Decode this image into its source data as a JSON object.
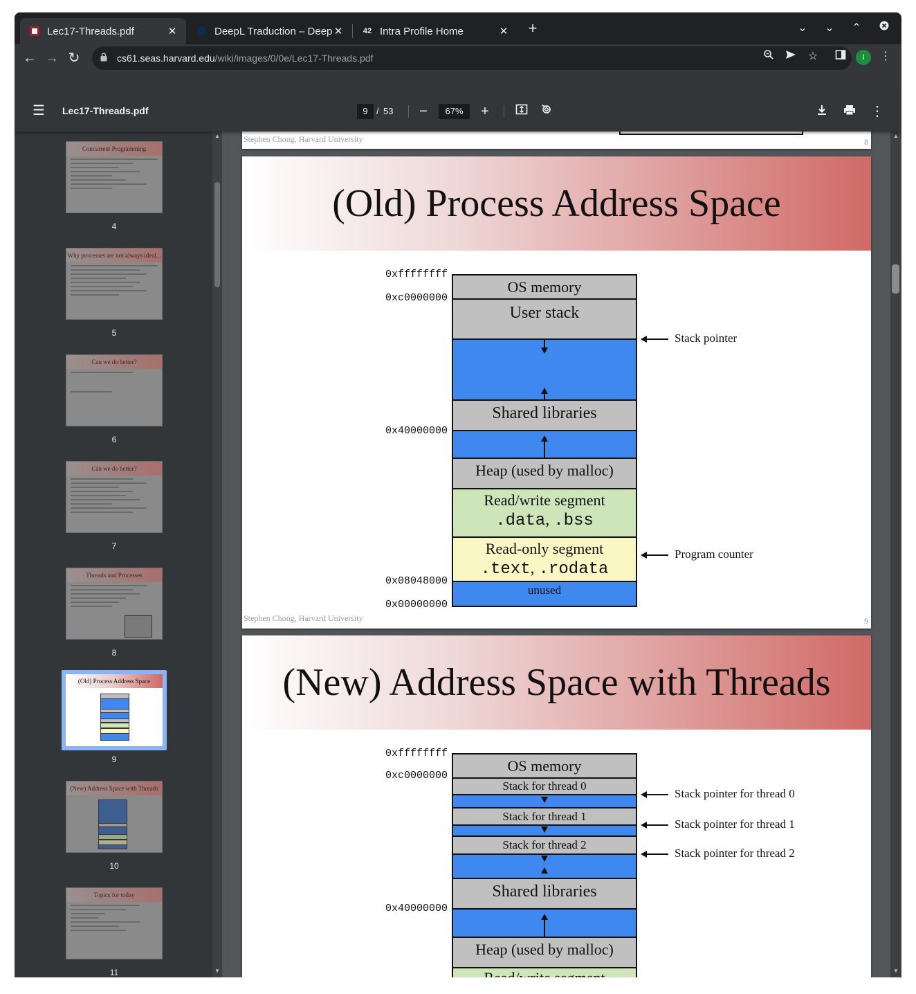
{
  "browser": {
    "tabs": [
      {
        "title": "Lec17-Threads.pdf",
        "active": true,
        "favicon": "harvard-shield-icon"
      },
      {
        "title": "DeepL Traduction – DeepL",
        "active": false,
        "favicon": "deepl-icon"
      },
      {
        "title": "Intra Profile Home",
        "active": false,
        "favicon": "42-logo-icon"
      }
    ],
    "url_host": "cs61.seas.harvard.edu",
    "url_path": "/wiki/images/0/0e/Lec17-Threads.pdf",
    "profile_initial": "I"
  },
  "viewer": {
    "filename": "Lec17-Threads.pdf",
    "current_page": "9",
    "page_separator": "/",
    "total_pages": "53",
    "zoom": "67%"
  },
  "thumbnails": [
    {
      "num": "4",
      "title": "Concurrent Programming"
    },
    {
      "num": "5",
      "title": "Why processes are not always ideal..."
    },
    {
      "num": "6",
      "title": "Can we do better?"
    },
    {
      "num": "7",
      "title": "Can we do better?"
    },
    {
      "num": "8",
      "title": "Threads and Processes"
    },
    {
      "num": "9",
      "title": "(Old) Process Address Space",
      "selected": true
    },
    {
      "num": "10",
      "title": "(New) Address Space with Threads"
    },
    {
      "num": "11",
      "title": "Topics for today"
    }
  ],
  "pages": {
    "page8_footer": {
      "author": "Stephen Chong, Harvard University",
      "num": "8"
    },
    "slide9": {
      "title": "(Old) Process Address Space",
      "footer_author": "Stephen Chong, Harvard University",
      "footer_num": "9",
      "addresses": [
        "0xffffffff",
        "0xc0000000",
        "0x40000000",
        "0x08048000",
        "0x00000000"
      ],
      "segments": {
        "os_memory": "OS memory",
        "user_stack": "User stack",
        "shared_libraries": "Shared libraries",
        "heap": "Heap (used by malloc)",
        "rw_segment": "Read/write segment",
        "rw_data": ".data",
        "rw_comma": ", ",
        "rw_bss": ".bss",
        "ro_segment": "Read-only segment",
        "ro_text": ".text",
        "ro_comma": ", ",
        "ro_rodata": ".rodata",
        "unused": "unused"
      },
      "annotations": {
        "stack_pointer": "Stack pointer",
        "program_counter": "Program counter"
      }
    },
    "slide10": {
      "title": "(New) Address Space with Threads",
      "addresses": [
        "0xffffffff",
        "0xc0000000",
        "0x40000000"
      ],
      "segments": {
        "os_memory": "OS memory",
        "stack0": "Stack for thread 0",
        "stack1": "Stack for thread 1",
        "stack2": "Stack for thread 2",
        "shared_libraries": "Shared libraries",
        "heap": "Heap (used by malloc)",
        "rw_segment": "Read/write segment"
      },
      "annotations": {
        "sp0": "Stack pointer for thread 0",
        "sp1": "Stack pointer for thread 1",
        "sp2": "Stack pointer for thread 2"
      }
    }
  }
}
